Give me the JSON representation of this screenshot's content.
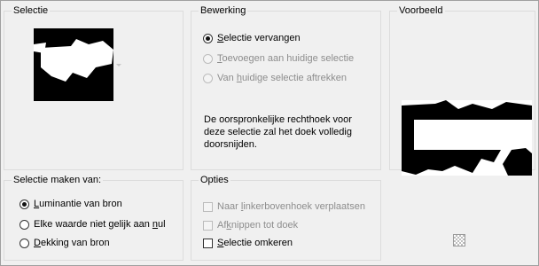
{
  "selectie": {
    "title": "Selectie"
  },
  "bewerking": {
    "title": "Bewerking",
    "options": [
      {
        "pre": "",
        "key": "S",
        "post": "electie vervangen",
        "checked": true,
        "enabled": true
      },
      {
        "pre": "",
        "key": "T",
        "post": "oevoegen aan huidige selectie",
        "checked": false,
        "enabled": false
      },
      {
        "pre": "Van ",
        "key": "h",
        "post": "uidige selectie aftrekken",
        "checked": false,
        "enabled": false
      }
    ],
    "info": "De oorspronkelijke rechthoek voor deze selectie zal het doek volledig doorsnijden."
  },
  "voorbeeld": {
    "title": "Voorbeeld"
  },
  "selectie_maken": {
    "title": "Selectie maken van:",
    "options": [
      {
        "pre": "",
        "key": "L",
        "post": "uminantie van bron",
        "checked": true
      },
      {
        "pre": "Elke waarde niet gelijk aan ",
        "key": "n",
        "post": "ul",
        "checked": false
      },
      {
        "pre": "",
        "key": "D",
        "post": "ekking van bron",
        "checked": false
      }
    ]
  },
  "opties": {
    "title": "Opties",
    "options": [
      {
        "pre": "Naar ",
        "key": "l",
        "post": "inkerbovenhoek verplaatsen",
        "checked": false,
        "enabled": false
      },
      {
        "pre": "Af",
        "key": "k",
        "post": "nippen tot doek",
        "checked": false,
        "enabled": false
      },
      {
        "pre": "",
        "key": "S",
        "post": "electie omkeren",
        "checked": false,
        "enabled": true
      }
    ]
  },
  "icons": {
    "dropdown": "chevron-down-icon",
    "transparency": "checkerboard-icon"
  },
  "colors": {
    "accent": "#000000",
    "disabled": "#8d8d8d",
    "background": "#f0f0f0"
  }
}
